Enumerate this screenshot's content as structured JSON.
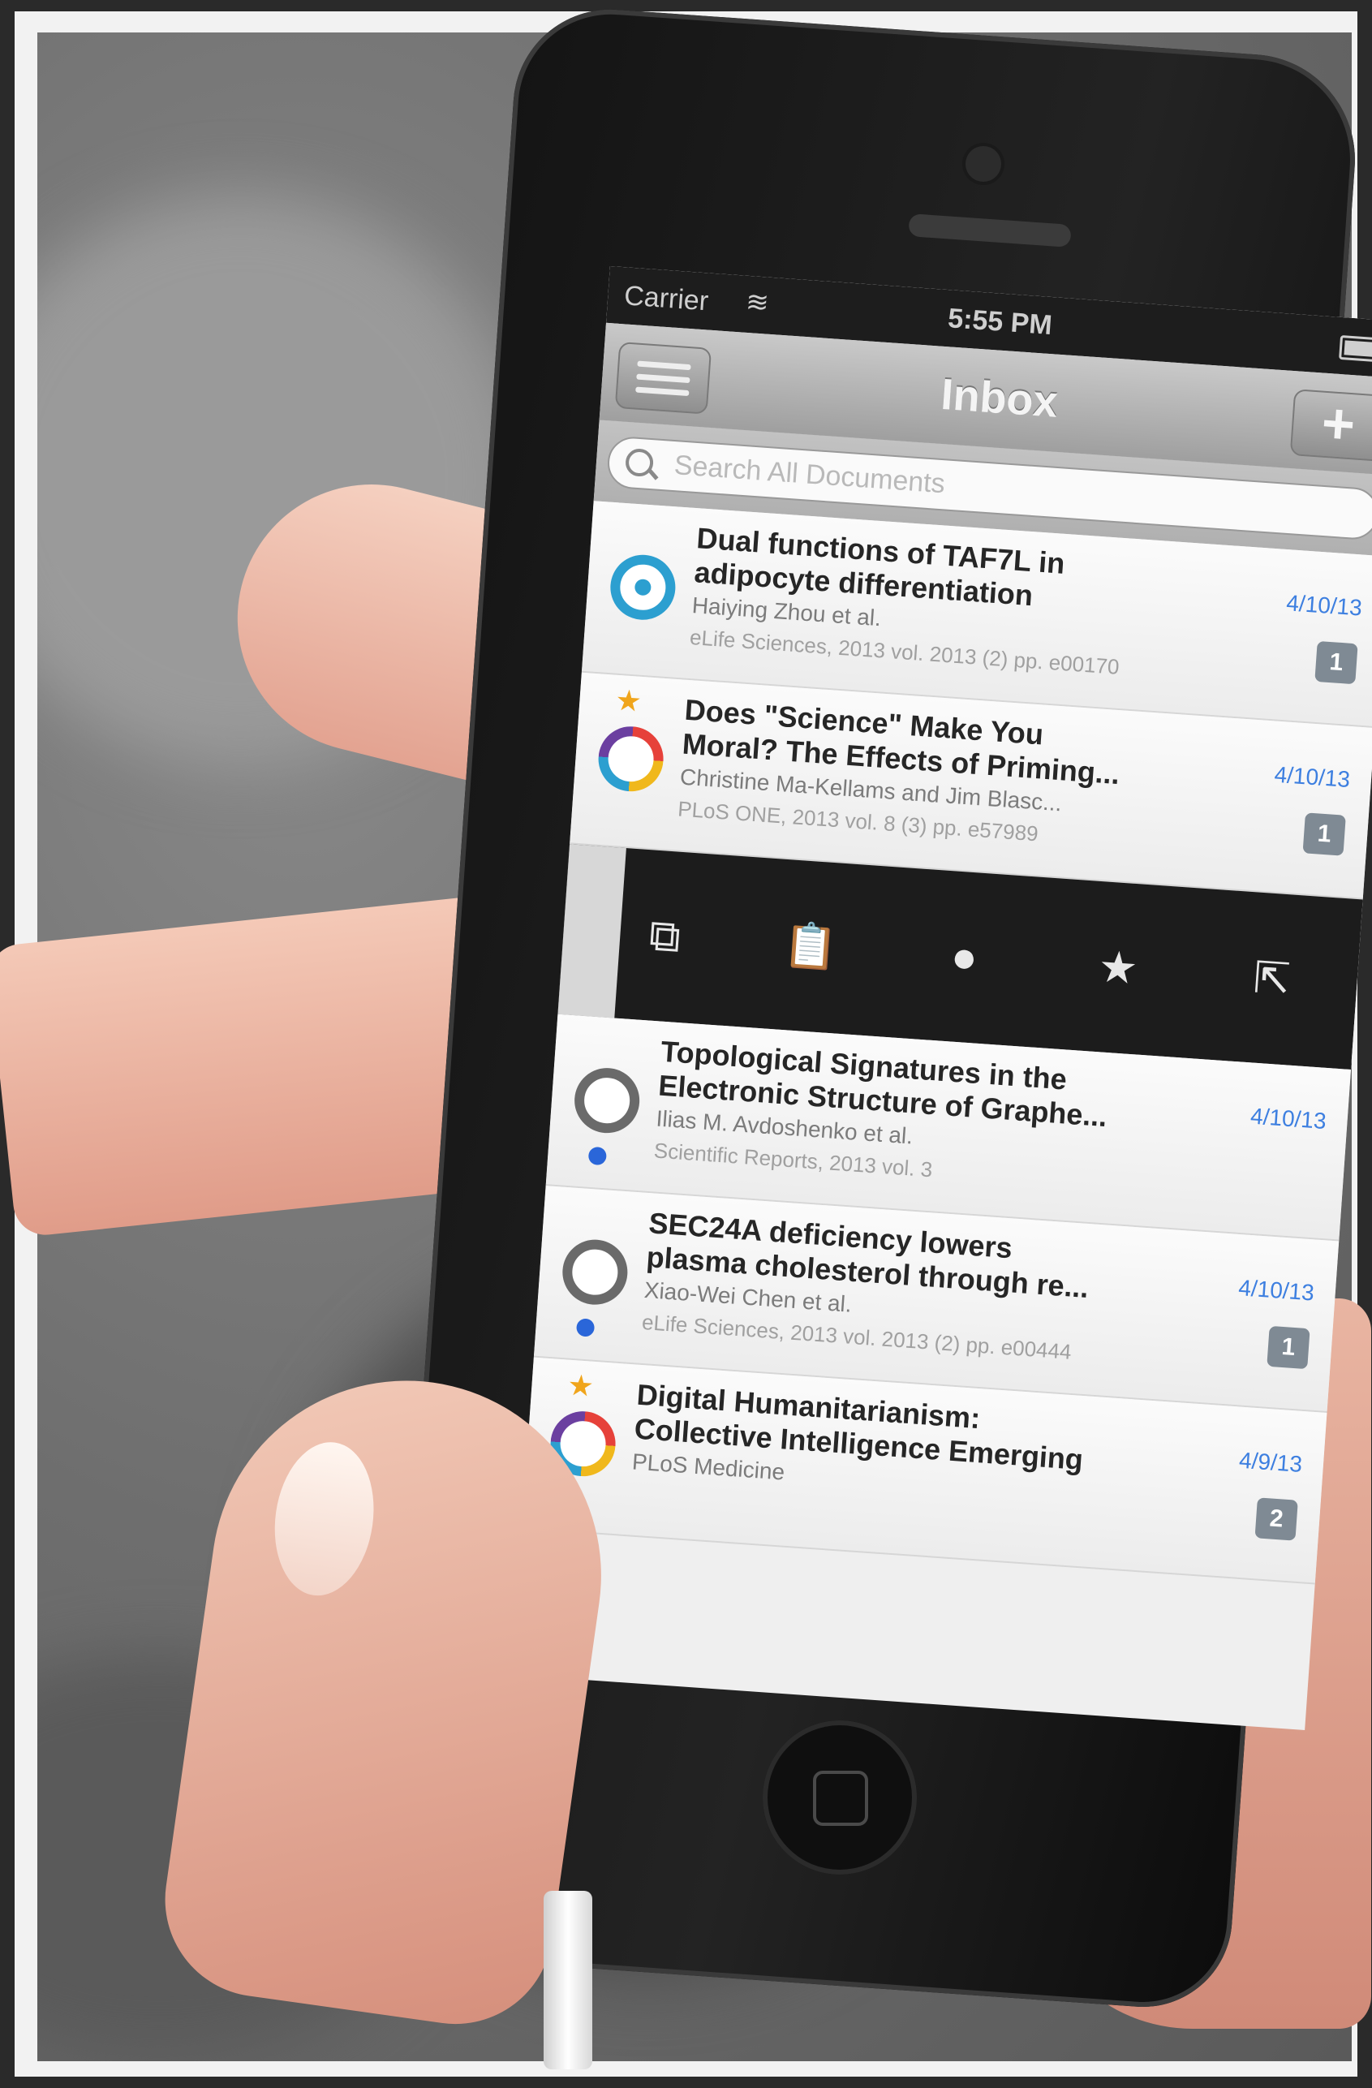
{
  "status": {
    "carrier": "Carrier",
    "time": "5:55 PM"
  },
  "nav": {
    "title": "Inbox",
    "add_label": "+"
  },
  "search": {
    "placeholder": "Search All Documents"
  },
  "documents": [
    {
      "title_line1": "Dual functions of TAF7L in",
      "title_line2": "adipocyte differentiation",
      "authors": "Haiying Zhou et al.",
      "source": "eLife Sciences, 2013 vol. 2013 (2) pp. e00170",
      "date": "4/10/13",
      "count": "1",
      "starred": false,
      "unread": false,
      "icon": "elife-circle-icon"
    },
    {
      "title_line1": "Does \"Science\" Make You",
      "title_line2": "Moral? The Effects of Priming...",
      "authors": "Christine Ma-Kellams and Jim Blasc...",
      "source": "PLoS ONE, 2013 vol. 8 (3) pp. e57989",
      "date": "4/10/13",
      "count": "1",
      "starred": true,
      "unread": false,
      "icon": "plos-circle-icon"
    },
    {
      "title_line1": "Topological Signatures in the",
      "title_line2": "Electronic Structure of Graphe...",
      "authors": "Ilias M. Avdoshenko et al.",
      "source": "Scientific Reports, 2013 vol. 3",
      "date": "4/10/13",
      "count": "",
      "starred": false,
      "unread": true,
      "icon": "journal-circle-icon"
    },
    {
      "title_line1": "SEC24A deficiency lowers",
      "title_line2": "plasma cholesterol through re...",
      "authors": "Xiao-Wei Chen et al.",
      "source": "eLife Sciences, 2013 vol. 2013 (2) pp. e00444",
      "date": "4/10/13",
      "count": "1",
      "starred": false,
      "unread": true,
      "icon": "journal-circle-icon"
    },
    {
      "title_line1": "Digital Humanitarianism:",
      "title_line2": "Collective Intelligence Emerging",
      "authors": "PLoS Medicine",
      "source": "",
      "date": "4/9/13",
      "count": "2",
      "starred": true,
      "unread": false,
      "icon": "plos-circle-icon"
    }
  ],
  "actions": [
    {
      "name": "archive-icon",
      "glyph": "⧉"
    },
    {
      "name": "clipboard-icon",
      "glyph": "📋"
    },
    {
      "name": "dot-icon",
      "glyph": "●"
    },
    {
      "name": "star-icon",
      "glyph": "★"
    },
    {
      "name": "share-icon",
      "glyph": "⇱"
    }
  ],
  "colors": {
    "accent_blue": "#3d7fe0",
    "star_orange": "#f0a51c",
    "unread_dot": "#2a66d9"
  }
}
